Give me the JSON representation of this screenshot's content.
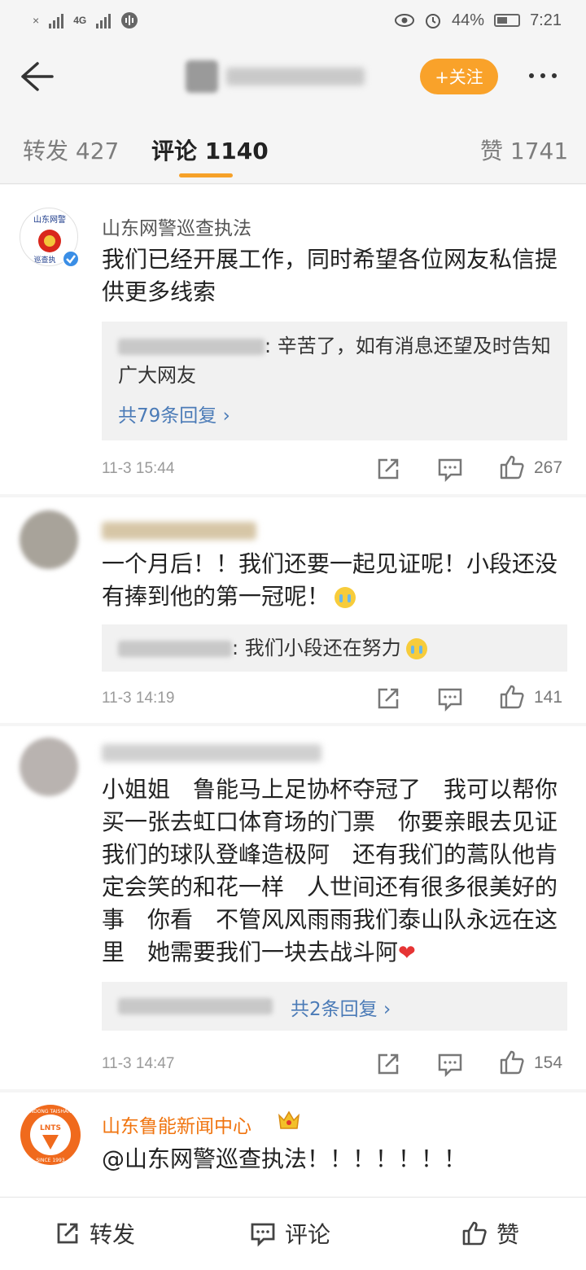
{
  "status_bar": {
    "network": "4G",
    "battery": "44%",
    "time": "7:21"
  },
  "header": {
    "follow_label": "+关注"
  },
  "tabs": [
    {
      "label": "转发 427"
    },
    {
      "label": "评论 1140"
    },
    {
      "label": "赞 1741"
    }
  ],
  "comments": [
    {
      "author": "山东网警巡查执法",
      "avatar_text": "山东网警\n巡查执",
      "text": "我们已经开展工作，同时希望各位网友私信提供更多线索",
      "reply_text": ": 辛苦了，如有消息还望及时告知广大网友",
      "reply_more": "共79条回复 ›",
      "time": "11-3 15:44",
      "likes": "267"
    },
    {
      "text": "一个月后！！我们还要一起见证呢！小段还没有捧到他的第一冠呢！",
      "reply_text": ": 我们小段还在努力",
      "time": "11-3 14:19",
      "likes": "141"
    },
    {
      "text": "小姐姐　鲁能马上足协杯夺冠了　我可以帮你买一张去虹口体育场的门票　你要亲眼去见证我们的球队登峰造极阿　还有我们的蒿队他肯定会笑的和花一样　人世间还有很多很美好的事　你看　不管风风雨雨我们泰山队永远在这里　她需要我们一块去战斗阿",
      "reply_more": "共2条回复 ›",
      "time": "11-3 14:47",
      "likes": "154"
    },
    {
      "author": "山东鲁能新闻中心",
      "avatar_text": "LNTS",
      "avatar_ring": "SHANDONG TAISHAN F.C.",
      "avatar_since": "SINCE 1993",
      "text": "@山东网警巡查执法！！！！！！！"
    }
  ],
  "bottom_bar": {
    "repost": "转发",
    "comment": "评论",
    "like": "赞"
  },
  "colors": {
    "accent": "#f9a22a",
    "link": "#4b7bb7",
    "brand_orange": "#f0740f"
  }
}
